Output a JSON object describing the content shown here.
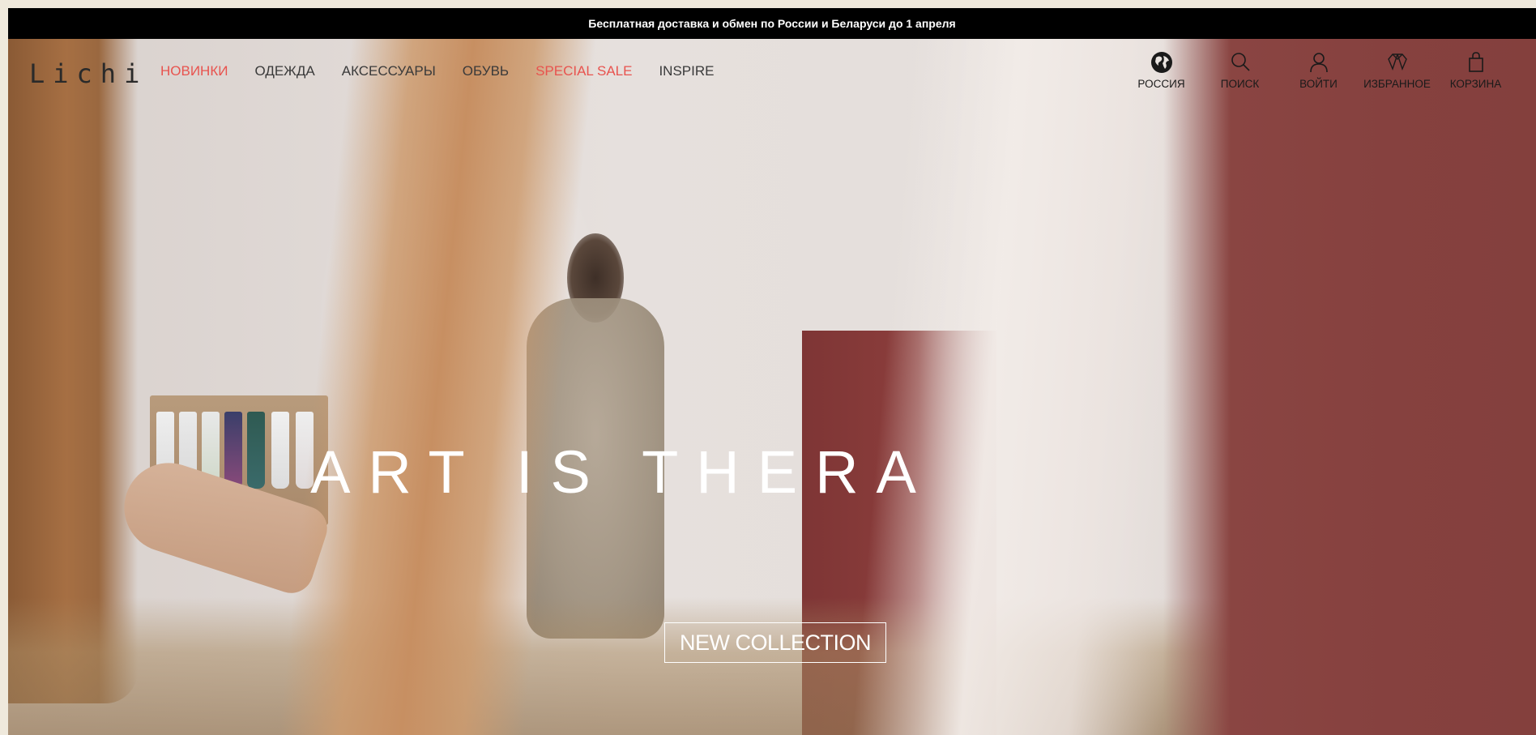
{
  "announcement": {
    "text": "Бесплатная доставка и обмен по России и Беларуси до 1 апреля"
  },
  "header": {
    "logo": "Lichi",
    "nav": [
      {
        "label": "НОВИНКИ",
        "accent": true
      },
      {
        "label": "ОДЕЖДА",
        "accent": false
      },
      {
        "label": "АКСЕССУАРЫ",
        "accent": false
      },
      {
        "label": "ОБУВЬ",
        "accent": false
      },
      {
        "label": "SPECIAL SALE",
        "accent": true
      },
      {
        "label": "INSPIRE",
        "accent": false
      }
    ],
    "tools": [
      {
        "label": "РОССИЯ",
        "icon": "globe-icon"
      },
      {
        "label": "ПОИСК",
        "icon": "search-icon"
      },
      {
        "label": "ВОЙТИ",
        "icon": "user-icon"
      },
      {
        "label": "ИЗБРАННОЕ",
        "icon": "heart-icon"
      },
      {
        "label": "КОРЗИНА",
        "icon": "bag-icon"
      }
    ]
  },
  "hero": {
    "title": "ART IS THERA",
    "cta_label": "NEW COLLECTION"
  },
  "colors": {
    "accent": "#e8534e",
    "announcement_bg": "#000000",
    "text": "#3a3a3a"
  }
}
